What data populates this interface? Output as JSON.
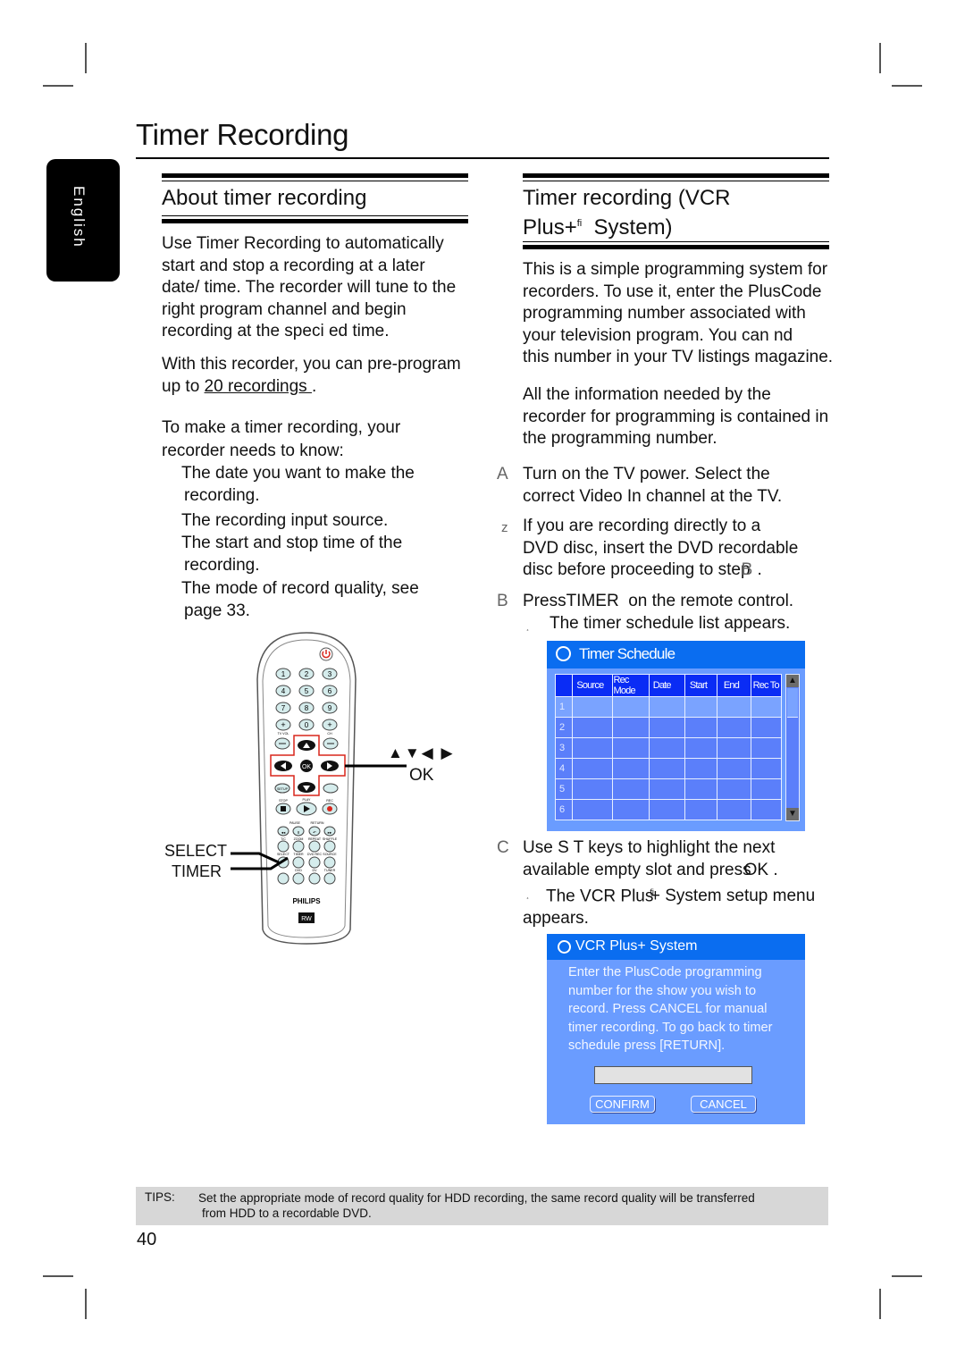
{
  "page": {
    "title": "Timer Recording",
    "language_tab": "English",
    "page_number": "40"
  },
  "left_column": {
    "heading": "About timer recording",
    "para1_lines": [
      "Use  Timer Recording  to automatically",
      "start and stop a recording at a later",
      "date/ time. The recorder will tune to the",
      "right program channel and begin",
      "recording at the speci ed time."
    ],
    "para2_line1": "With this recorder, you can pre-program",
    "para2_prefix": "up to ",
    "para2_link": "20 recordings ",
    "para2_suffix": ".",
    "para3_lines": [
      "To make a timer recording, your",
      "recorder needs to know:"
    ],
    "needs": [
      {
        "line1": "The date you want to make the",
        "line2": "recording."
      },
      {
        "line1": "The recording input source.",
        "line2": ""
      },
      {
        "line1": "The start and stop time of the",
        "line2": "recording."
      },
      {
        "line1": "The mode of record quality, see",
        "line2": "page 33."
      }
    ],
    "remote": {
      "callout_arrows": "▲▼◀ ▶",
      "callout_ok": "OK",
      "callout_select": "SELECT",
      "callout_timer": "TIMER",
      "brand": "PHILIPS",
      "logo": "RW",
      "digits": [
        "1",
        "2",
        "3",
        "4",
        "5",
        "6",
        "7",
        "8",
        "9"
      ],
      "zero": "0",
      "tv_vol_label": "TV VOL",
      "ch_label": "CH",
      "ok_label": "OK",
      "setup_label": "SETUP",
      "stop_label": "STOP",
      "play_label": "PLAY",
      "rec_label": "REC",
      "pause_label": "PAUSE",
      "return_label": "RETURN",
      "row_labels_1": [
        "T/C",
        "ZOOM",
        "REPEAT",
        "SHUFFLE"
      ],
      "row_labels_2": [
        "SELECT",
        "TIMER",
        "DVD REC",
        "SOURCE"
      ],
      "row_labels_3": [
        "",
        "DVD",
        "DV",
        "TUNER"
      ]
    }
  },
  "right_column": {
    "heading_line1": "Timer recording (VCR",
    "heading_line2": "Plus+ª System)",
    "heading_line2_main": "Plus+",
    "heading_line2_sup": "fi",
    "heading_line2_end": "  System)",
    "para1_lines": [
      "This is a simple programming system for",
      "recorders. To use it, enter the PlusCode",
      "programming number associated with",
      "your television program. You can  nd",
      "this number in your TV listings magazine."
    ],
    "para2_lines": [
      "All the information needed by the",
      "recorder for programming is contained in",
      "the programming number."
    ],
    "steps": {
      "a_marker": "A",
      "a_lines": [
        "Turn on the TV power. Select the",
        "correct Video In channel at the TV."
      ],
      "z_marker": "z",
      "z_lines": [
        "If you are recording directly to a",
        "DVD disc,  insert the DVD recordable",
        "disc before proceeding to step"
      ],
      "z_ref": "B",
      "z_end": " .",
      "b_marker": "B",
      "b_press": "Press",
      "b_key": "TIMER",
      "b_rest": "  on the remote control.",
      "b_result_marker": "¸",
      "b_result": "The timer schedule list appears.",
      "c_marker": "C",
      "c_line1": "Use S T  keys to highlight the next",
      "c_line2_pre": "available empty slot and press",
      "c_line2_key": "OK",
      "c_line2_end": " .",
      "c_result_marker": "¸",
      "c_result_pre": "The VCR Plus",
      "c_result_sup": "fi",
      "c_result_post": "+ System setup menu",
      "c_result_line2": "appears."
    },
    "timer_schedule": {
      "title": "Timer Schedule",
      "columns": [
        "Source",
        "Rec Mode",
        "Date",
        "Start",
        "End",
        "Rec To"
      ],
      "rows": [
        "1",
        "2",
        "3",
        "4",
        "5",
        "6"
      ],
      "scroll_up": "▲",
      "scroll_down": "▼"
    },
    "vcr_plus": {
      "title": "VCR Plus+ System",
      "text_lines": [
        "Enter the PlusCode programming",
        "number for the show you wish to",
        "record. Press CANCEL for manual",
        "timer recording. To go back to timer",
        "schedule press [RETURN]."
      ],
      "input_value": "",
      "confirm_label": "CONFIRM",
      "cancel_label": "CANCEL"
    }
  },
  "tips": {
    "label": "TIPS:",
    "line1": "Set the appropriate mode of record quality for HDD recording, the same record quality will be transferred",
    "line2": "from HDD to a recordable DVD."
  },
  "colors": {
    "osd_header": "#0a6df0",
    "osd_body": "#6a9cff",
    "osd_table_header": "#0a2cf5",
    "osd_row": "#5b7ffa",
    "highlight_red": "#d9261c",
    "remote_key": "#d5ecec",
    "tips_bg": "#d7d7d7"
  }
}
